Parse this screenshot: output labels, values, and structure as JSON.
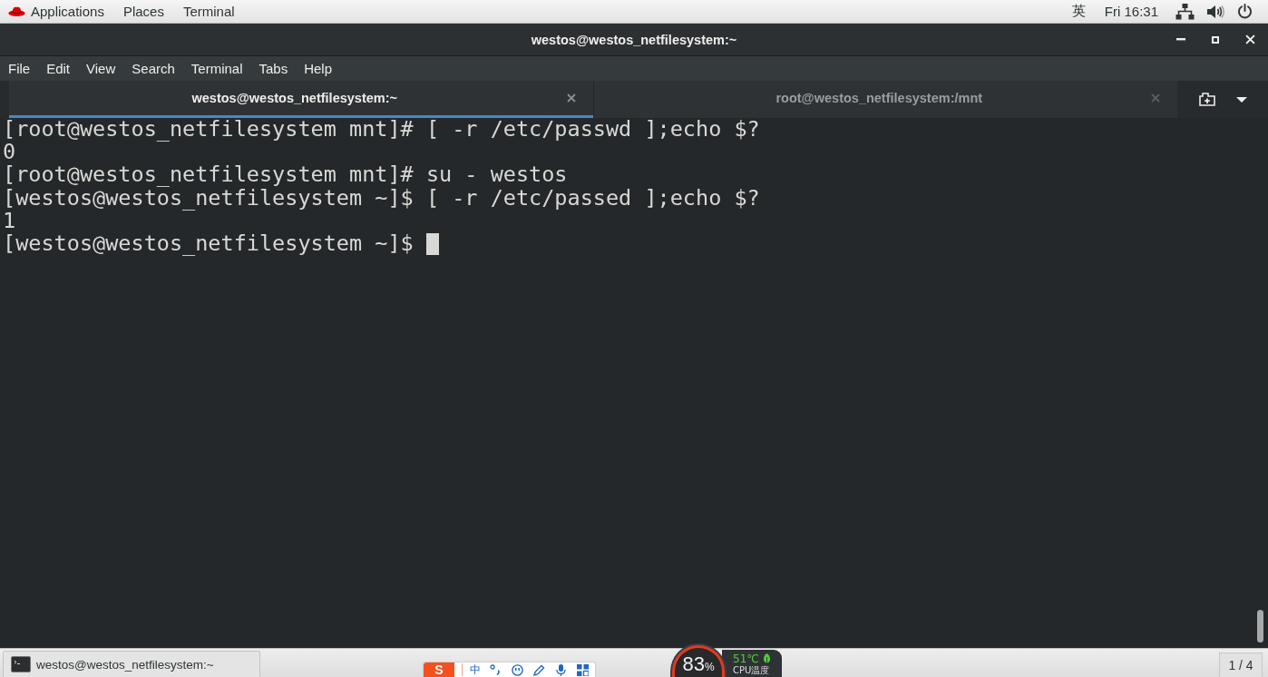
{
  "top_bar": {
    "menus": [
      {
        "label": "Applications",
        "kind": "logo"
      },
      {
        "label": "Places",
        "kind": "plain"
      },
      {
        "label": "Terminal",
        "kind": "plain"
      }
    ],
    "input_method": "英",
    "clock": "Fri 16:31"
  },
  "window": {
    "title": "westos@westos_netfilesystem:~"
  },
  "menu_bar": [
    "File",
    "Edit",
    "View",
    "Search",
    "Terminal",
    "Tabs",
    "Help"
  ],
  "tabs": [
    {
      "label": "westos@westos_netfilesystem:~",
      "selected": true
    },
    {
      "label": "root@westos_netfilesystem:/mnt",
      "selected": false
    }
  ],
  "terminal": {
    "lines": [
      {
        "text": "[root@westos_netfilesystem mnt]# [ -r /etc/passwd ];echo $?",
        "cursor": false
      },
      {
        "text": "0",
        "cursor": false
      },
      {
        "text": "[root@westos_netfilesystem mnt]# su - westos",
        "cursor": false
      },
      {
        "text": "[westos@westos_netfilesystem ~]$ [ -r /etc/passed ];echo $?",
        "cursor": false
      },
      {
        "text": "1",
        "cursor": false
      },
      {
        "text": "[westos@westos_netfilesystem ~]$",
        "cursor": true
      }
    ]
  },
  "taskbar": {
    "windows": [
      {
        "label": "westos@westos_netfilesystem:~"
      }
    ],
    "workspace": "1 / 4"
  },
  "ime_toolbar": {
    "logo": "S",
    "mode": "中"
  },
  "cpu_monitor": {
    "usage": "83",
    "usage_unit": "%",
    "temperature": "51℃",
    "label": "CPU温度"
  }
}
